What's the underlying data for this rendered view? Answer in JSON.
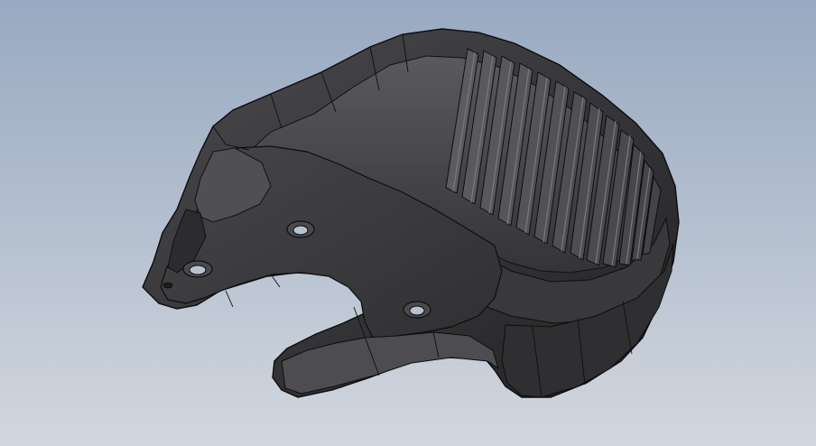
{
  "viewport": {
    "background_top": "#98a9c1",
    "background_bottom": "#d2d7de"
  },
  "model": {
    "icon": "cad-part-icon",
    "body_color": "#3d3d3f",
    "shade_color": "#2a2a2c",
    "highlight_color": "#6e6e72",
    "edge_color": "#0d0d0d",
    "rib_count": 13,
    "hole_count": 4
  }
}
